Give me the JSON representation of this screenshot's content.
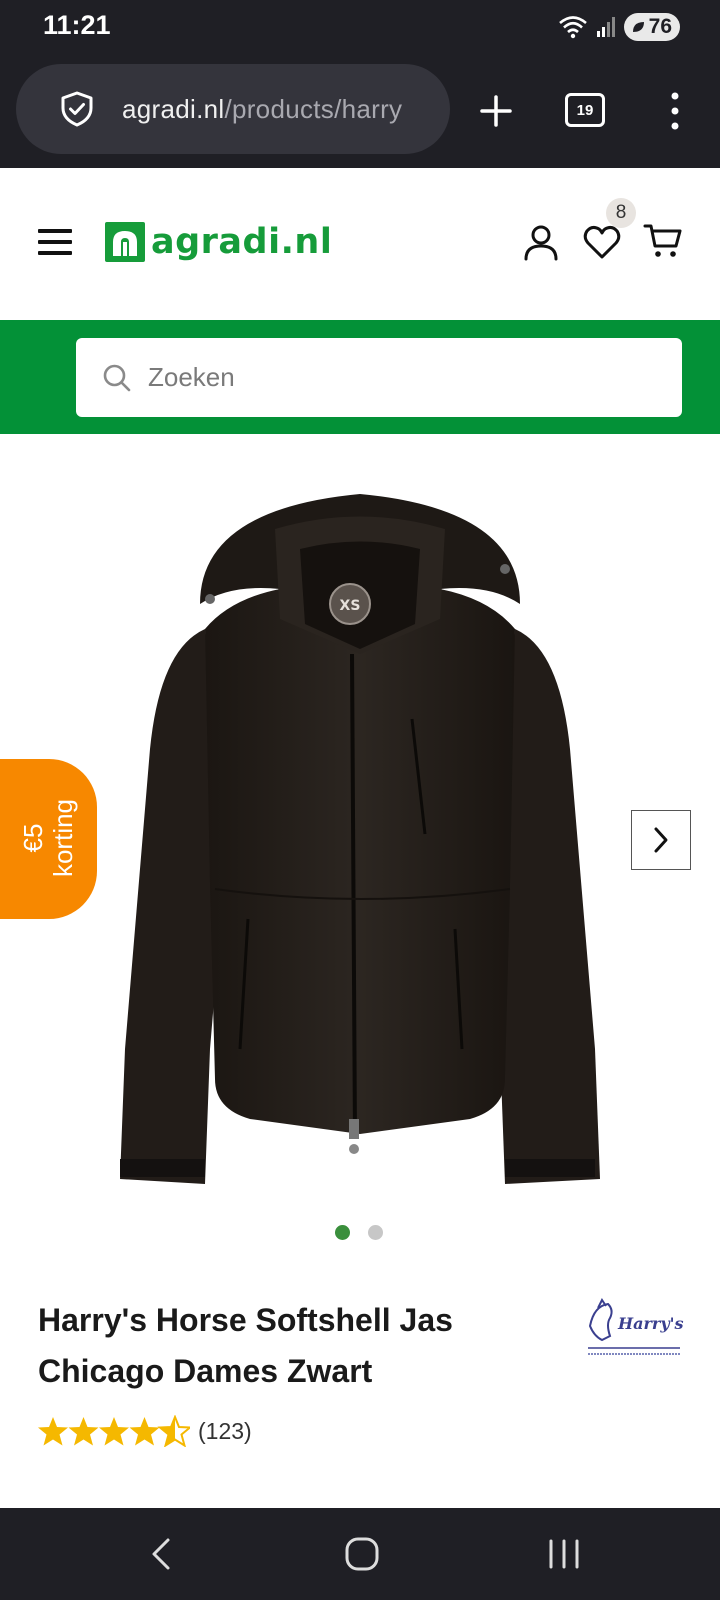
{
  "status_bar": {
    "time": "11:21",
    "battery": "76"
  },
  "browser": {
    "url_host": "agradi.nl",
    "url_path": "/products/harry",
    "tab_count": "19"
  },
  "site": {
    "logo_text": "agradi.nl",
    "wishlist_count": "8",
    "brand_color": "#169c3a",
    "band_color": "#039137"
  },
  "search": {
    "placeholder": "Zoeken"
  },
  "product": {
    "discount_amount": "€5",
    "discount_label": "korting",
    "title": "Harry's Horse Softshell Jas Chicago Dames Zwart",
    "size_label": "XS",
    "brand_logo_text": "Harry's Horse",
    "rating": 4.5,
    "review_count": "(123)",
    "image_count": 2,
    "active_image": 1
  },
  "icons": [
    "shield-icon",
    "plus-icon",
    "tabs-icon",
    "more-vert-icon",
    "menu-icon",
    "user-icon",
    "heart-icon",
    "cart-icon",
    "search-icon",
    "chevron-right-icon",
    "back-icon",
    "home-icon",
    "recents-icon"
  ]
}
